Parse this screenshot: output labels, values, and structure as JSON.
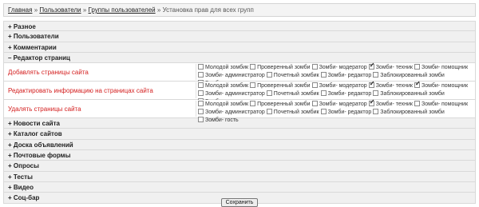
{
  "breadcrumb": {
    "home": "Главная",
    "users": "Пользователи",
    "groups": "Группы пользователей",
    "current": "Установка прав для всех групп",
    "separator": "»"
  },
  "sections_top": [
    "+ Разное",
    "+ Пользователи",
    "+ Комментарии",
    "– Редактор страниц"
  ],
  "permissions": [
    {
      "label": "Добавлять страницы сайта",
      "options": [
        {
          "label": "Молодой зомбик",
          "checked": false
        },
        {
          "label": "Проверенный зомби",
          "checked": false
        },
        {
          "label": "Зомби- модератор",
          "checked": false
        },
        {
          "label": "Зомби- техник",
          "checked": true
        },
        {
          "label": "Зомби- помощник",
          "checked": false
        },
        {
          "label": "Зомби- администратор",
          "checked": false
        },
        {
          "label": "Почетный зомбик",
          "checked": false
        },
        {
          "label": "Зомби- редактор",
          "checked": false
        },
        {
          "label": "Заблокированный зомби",
          "checked": false
        },
        {
          "label": "Зомби- гость",
          "checked": false
        }
      ]
    },
    {
      "label": "Редактировать информацию на страницах сайта",
      "options": [
        {
          "label": "Молодой зомбик",
          "checked": false
        },
        {
          "label": "Проверенный зомби",
          "checked": false
        },
        {
          "label": "Зомби- модератор",
          "checked": false
        },
        {
          "label": "Зомби- техник",
          "checked": true
        },
        {
          "label": "Зомби- помощник",
          "checked": true
        },
        {
          "label": "Зомби- администратор",
          "checked": false
        },
        {
          "label": "Почетный зомбик",
          "checked": false
        },
        {
          "label": "Зомби- редактор",
          "checked": false
        },
        {
          "label": "Заблокированный зомби",
          "checked": false
        },
        {
          "label": "Зомби- гость",
          "checked": false
        }
      ]
    },
    {
      "label": "Удалять страницы сайта",
      "options": [
        {
          "label": "Молодой зомбик",
          "checked": false
        },
        {
          "label": "Проверенный зомби",
          "checked": false
        },
        {
          "label": "Зомби- модератор",
          "checked": false
        },
        {
          "label": "Зомби- техник",
          "checked": true
        },
        {
          "label": "Зомби- помощник",
          "checked": false
        },
        {
          "label": "Зомби- администратор",
          "checked": false
        },
        {
          "label": "Почетный зомбик",
          "checked": false
        },
        {
          "label": "Зомби- редактор",
          "checked": false
        },
        {
          "label": "Заблокированный зомби",
          "checked": false
        },
        {
          "label": "Зомби- гость",
          "checked": false
        }
      ]
    }
  ],
  "sections_bottom": [
    "+ Новости сайта",
    "+ Каталог сайтов",
    "+ Доска объявлений",
    "+ Почтовые формы",
    "+ Опросы",
    "+ Тесты",
    "+ Видео",
    "+ Соц-бар"
  ],
  "save_label": "Сохранить",
  "colors": {
    "permission_label": "#d42020",
    "section_bg": "#f0f0f0",
    "border": "#d9d9d9"
  }
}
